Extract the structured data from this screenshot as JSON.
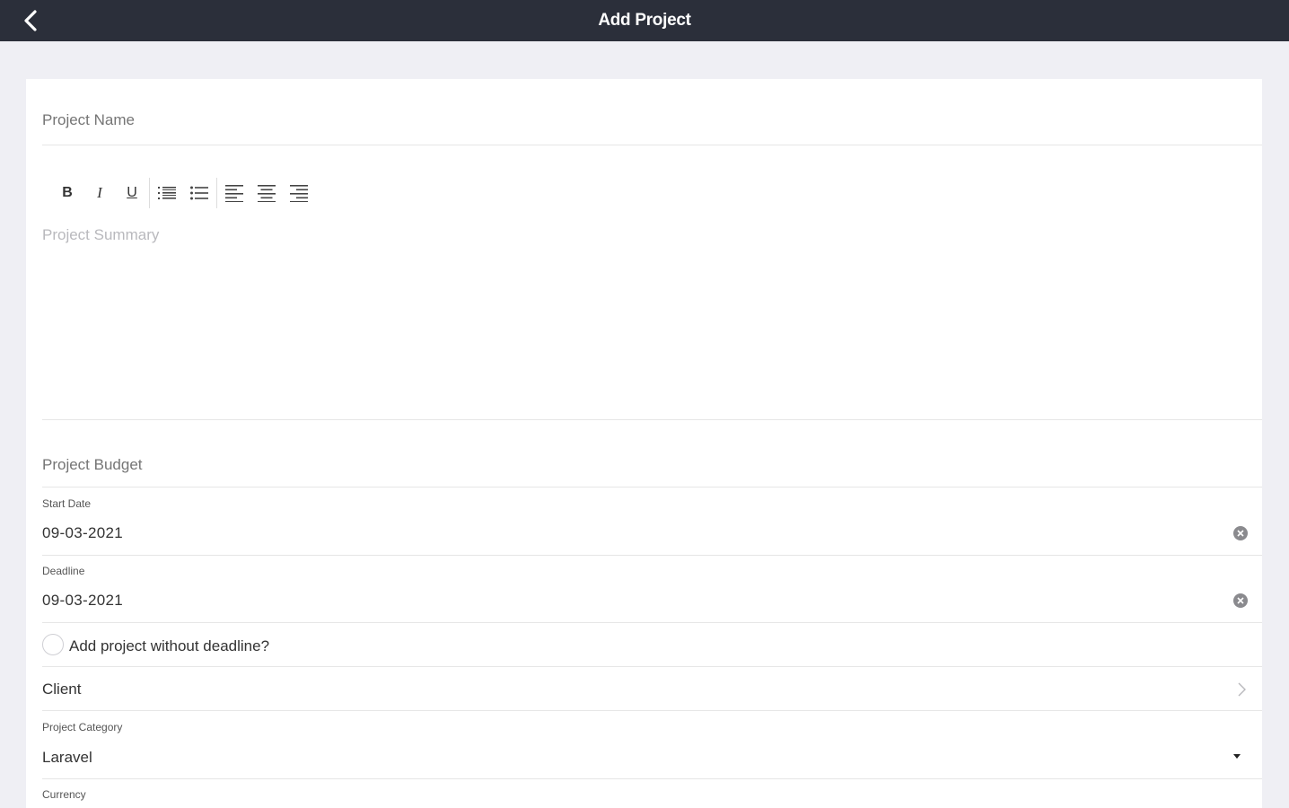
{
  "header": {
    "title": "Add Project",
    "back_icon": "chevron-left-icon"
  },
  "form": {
    "project_name": {
      "placeholder": "Project Name",
      "value": ""
    },
    "editor": {
      "toolbar": [
        "bold",
        "italic",
        "underline",
        "ordered-list",
        "bullet-list",
        "align-left",
        "align-center",
        "align-right"
      ],
      "toolbar_labels": {
        "bold": "B",
        "italic": "I",
        "underline": "U"
      },
      "placeholder": "Project Summary"
    },
    "budget": {
      "placeholder": "Project Budget"
    },
    "start_date": {
      "label": "Start Date",
      "value": "09-03-2021"
    },
    "deadline": {
      "label": "Deadline",
      "value": "09-03-2021"
    },
    "no_deadline": {
      "label": "Add project without deadline?",
      "checked": false
    },
    "client": {
      "label": "Client"
    },
    "category": {
      "label": "Project Category",
      "value": "Laravel"
    },
    "currency": {
      "label": "Currency"
    }
  },
  "colors": {
    "topbar": "#2b2f3a",
    "background": "#efeff4",
    "card": "#ffffff",
    "placeholder": "#b9b9bd",
    "divider": "#e6e6e6"
  }
}
